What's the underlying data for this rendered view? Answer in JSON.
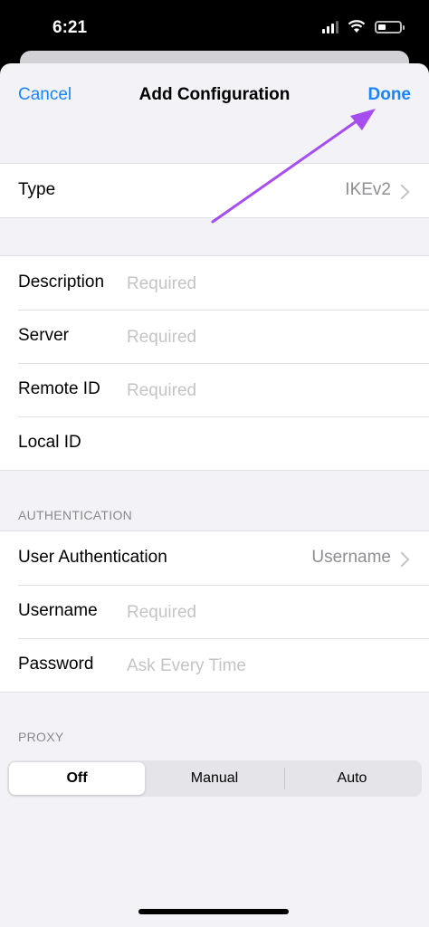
{
  "status_bar": {
    "time": "6:21",
    "icons": [
      "cellular-signal-icon",
      "wifi-icon",
      "battery-icon"
    ],
    "battery_level": 0.35
  },
  "nav": {
    "cancel_label": "Cancel",
    "title": "Add Configuration",
    "done_label": "Done"
  },
  "type_row": {
    "label": "Type",
    "value": "IKEv2"
  },
  "details": [
    {
      "label": "Description",
      "placeholder": "Required"
    },
    {
      "label": "Server",
      "placeholder": "Required"
    },
    {
      "label": "Remote ID",
      "placeholder": "Required"
    },
    {
      "label": "Local ID",
      "placeholder": ""
    }
  ],
  "authentication": {
    "header": "AUTHENTICATION",
    "user_auth_label": "User Authentication",
    "user_auth_value": "Username",
    "username_label": "Username",
    "username_placeholder": "Required",
    "password_label": "Password",
    "password_placeholder": "Ask Every Time"
  },
  "proxy": {
    "header": "PROXY",
    "options": [
      "Off",
      "Manual",
      "Auto"
    ],
    "selected": "Off"
  },
  "colors": {
    "accent": "#1a84ff",
    "annotation_arrow": "#a64df0"
  }
}
